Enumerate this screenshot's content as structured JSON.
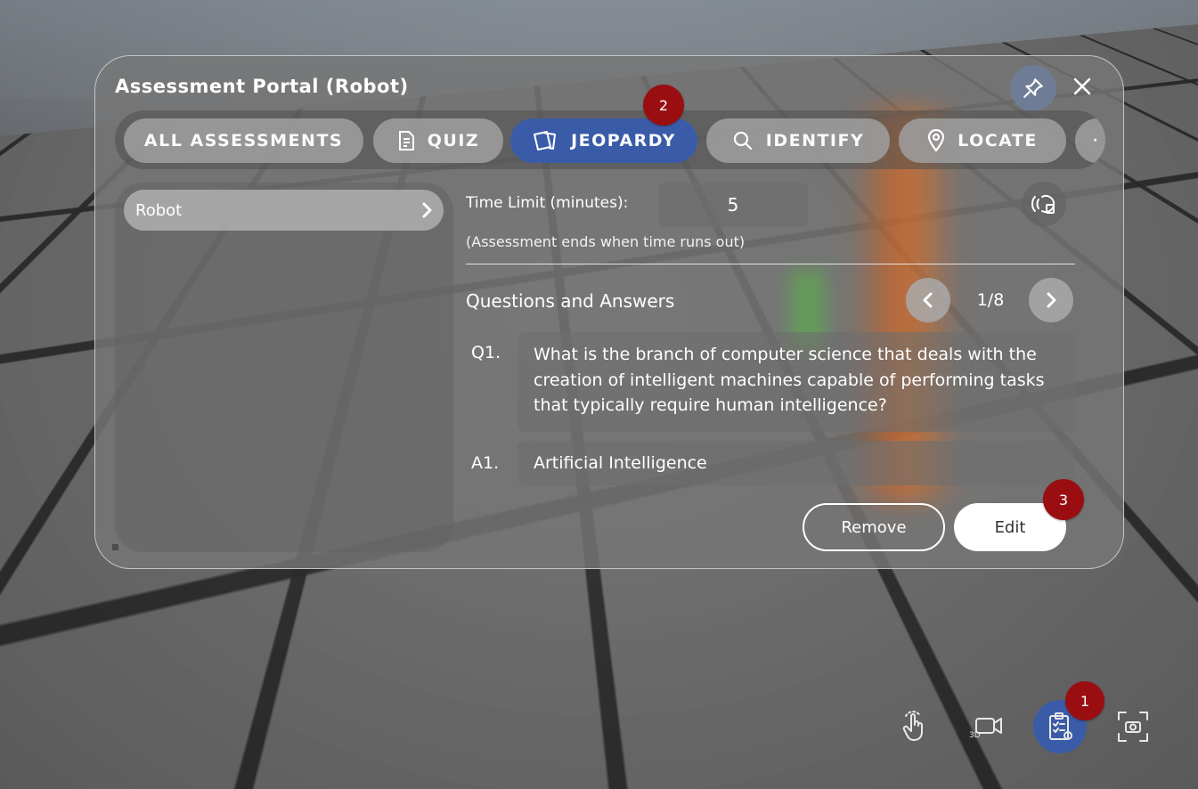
{
  "panel": {
    "title": "Assessment Portal (Robot)"
  },
  "header": {
    "pin_icon": "pin-icon",
    "close_icon": "close-icon"
  },
  "tabs": [
    {
      "label": "ALL ASSESSMENTS",
      "icon": "",
      "active": false
    },
    {
      "label": "QUIZ",
      "icon": "document-icon",
      "active": false
    },
    {
      "label": "JEOPARDY",
      "icon": "cards-icon",
      "active": true
    },
    {
      "label": "IDENTIFY",
      "icon": "search-icon",
      "active": false
    },
    {
      "label": "LOCATE",
      "icon": "location-pin-icon",
      "active": false
    }
  ],
  "sidebar": {
    "items": [
      {
        "label": "Robot"
      }
    ]
  },
  "settings": {
    "time_limit_label": "Time Limit (minutes):",
    "time_limit_value": "5",
    "note": "(Assessment ends when time runs out)"
  },
  "qa": {
    "heading": "Questions and Answers",
    "page_indicator": "1/8",
    "question_label": "Q1.",
    "question_text": "What is the branch of computer science that deals with the creation of intelligent machines capable of performing tasks that typically require human intelligence?",
    "answer_label": "A1.",
    "answer_text": "Artificial Intelligence"
  },
  "actions": {
    "remove_label": "Remove",
    "edit_label": "Edit"
  },
  "badges": {
    "one": "1",
    "two": "2",
    "three": "3"
  },
  "colors": {
    "accent": "#3a5ca8",
    "badge": "#9a0e12"
  }
}
